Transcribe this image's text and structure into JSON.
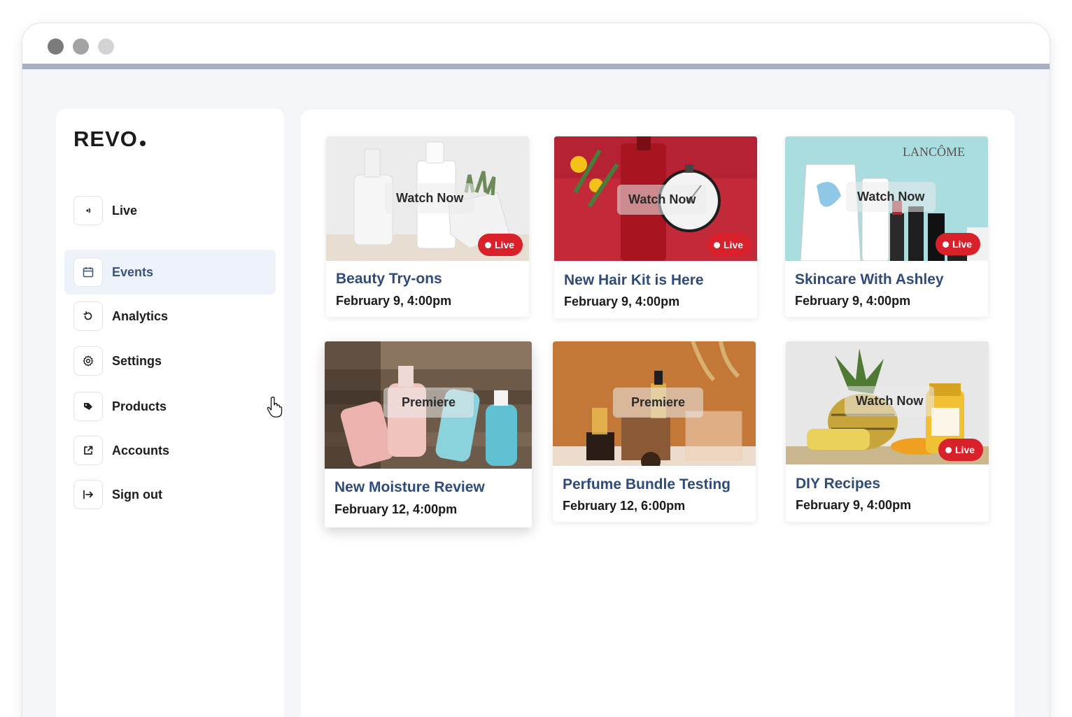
{
  "app": {
    "logo": "REVO"
  },
  "sidebar": {
    "items": [
      {
        "label": "Live",
        "icon": "broadcast-icon"
      },
      {
        "label": "Events",
        "icon": "calendar-icon",
        "active": true
      },
      {
        "label": "Analytics",
        "icon": "refresh-icon"
      },
      {
        "label": "Settings",
        "icon": "gear-icon"
      },
      {
        "label": "Products",
        "icon": "tag-icon"
      },
      {
        "label": "Accounts",
        "icon": "external-link-icon"
      },
      {
        "label": "Sign out",
        "icon": "sign-out-icon"
      }
    ]
  },
  "events": [
    {
      "title": "Beauty Try-ons",
      "date": "February 9, 4:00pm",
      "action": "Watch Now",
      "live": true
    },
    {
      "title": "New Hair Kit is Here",
      "date": "February 9, 4:00pm",
      "action": "Watch Now",
      "live": true
    },
    {
      "title": "Skincare With Ashley",
      "date": "February 9, 4:00pm",
      "action": "Watch Now",
      "live": true
    },
    {
      "title": "New Moisture Review",
      "date": "February 12, 4:00pm",
      "action": "Premiere",
      "live": false
    },
    {
      "title": "Perfume Bundle Testing",
      "date": "February 12, 6:00pm",
      "action": "Premiere",
      "live": false
    },
    {
      "title": "DIY Recipes",
      "date": "February 9, 4:00pm",
      "action": "Watch Now",
      "live": true
    }
  ],
  "badges": {
    "live_label": "Live"
  },
  "colors": {
    "accent": "#2f4b7c",
    "live": "#d8212a",
    "active_bg": "#eef2fb"
  }
}
